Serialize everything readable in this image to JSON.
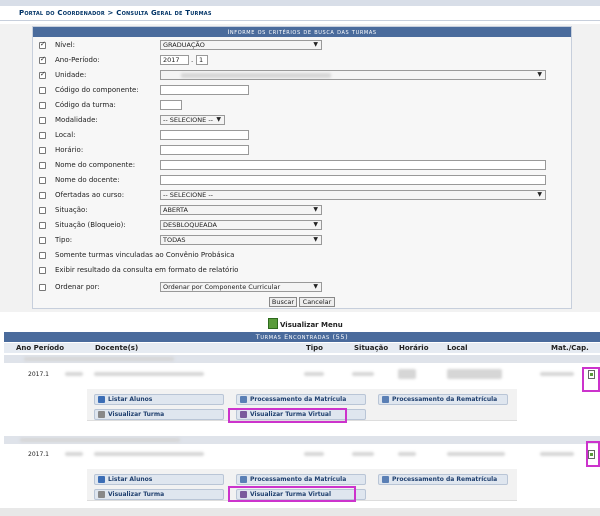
{
  "breadcrumb": "Portal do Coordenador > Consulta Geral de Turmas",
  "form": {
    "title": "Informe os critérios de busca das turmas",
    "rows": [
      {
        "label": "Nível:",
        "checked": true
      },
      {
        "label": "Ano-Período:",
        "checked": true
      },
      {
        "label": "Unidade:",
        "checked": true
      },
      {
        "label": "Código do componente:",
        "checked": false
      },
      {
        "label": "Código da turma:",
        "checked": false
      },
      {
        "label": "Modalidade:",
        "checked": false
      },
      {
        "label": "Local:",
        "checked": false
      },
      {
        "label": "Horário:",
        "checked": false
      },
      {
        "label": "Nome do componente:",
        "checked": false
      },
      {
        "label": "Nome do docente:",
        "checked": false
      },
      {
        "label": "Ofertadas ao curso:",
        "checked": false
      },
      {
        "label": "Situação:",
        "checked": false
      },
      {
        "label": "Situação (Bloqueio):",
        "checked": false
      },
      {
        "label": "Tipo:",
        "checked": false
      },
      {
        "label": "Somente turmas vinculadas ao Convênio Probásica",
        "checked": false
      },
      {
        "label": "Exibir resultado da consulta em formato de relatório",
        "checked": false
      },
      {
        "label": "Ordenar por:",
        "checked": false
      }
    ],
    "values": {
      "nivel": "GRADUAÇÃO",
      "ano": "2017",
      "periodo": "1",
      "modalidade": "-- SELECIONE --",
      "ofertadas": "-- SELECIONE --",
      "situacao": "ABERTA",
      "bloqueio": "DESBLOQUEADA",
      "tipo": "TODAS",
      "ordenar": "Ordenar por Componente Curricular"
    },
    "buttons": {
      "buscar": "Buscar",
      "cancelar": "Cancelar"
    }
  },
  "visualizar_menu": "Visualizar Menu",
  "results": {
    "title": "Turmas Encontradas (55)",
    "headers": {
      "ano": "Ano Período",
      "docente": "Docente(s)",
      "tipo": "Tipo",
      "situacao": "Situação",
      "horario": "Horário",
      "local": "Local",
      "matcap": "Mat./Cap."
    },
    "rows": [
      {
        "ano": "2017.1"
      },
      {
        "ano": "2017.1"
      }
    ],
    "actions": {
      "listar": "Listar Alunos",
      "visualizar": "Visualizar Turma",
      "proc_matricula": "Processamento da Matrícula",
      "proc_rematricula": "Processamento da Rematrícula",
      "turma_virtual": "Visualizar Turma Virtual"
    }
  },
  "colors": {
    "header_blue": "#4a6b9c",
    "highlight": "#cc33cc"
  }
}
